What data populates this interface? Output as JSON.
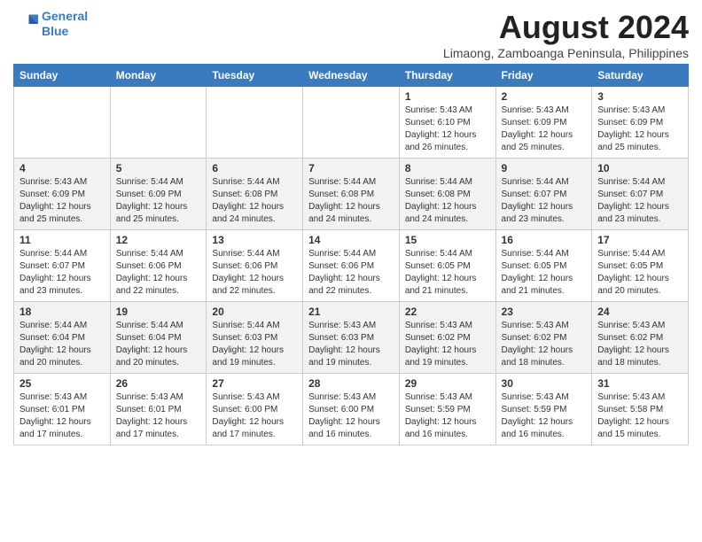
{
  "logo": {
    "line1": "General",
    "line2": "Blue"
  },
  "title": "August 2024",
  "subtitle": "Limaong, Zamboanga Peninsula, Philippines",
  "days_of_week": [
    "Sunday",
    "Monday",
    "Tuesday",
    "Wednesday",
    "Thursday",
    "Friday",
    "Saturday"
  ],
  "weeks": [
    [
      {
        "day": "",
        "info": ""
      },
      {
        "day": "",
        "info": ""
      },
      {
        "day": "",
        "info": ""
      },
      {
        "day": "",
        "info": ""
      },
      {
        "day": "1",
        "info": "Sunrise: 5:43 AM\nSunset: 6:10 PM\nDaylight: 12 hours\nand 26 minutes."
      },
      {
        "day": "2",
        "info": "Sunrise: 5:43 AM\nSunset: 6:09 PM\nDaylight: 12 hours\nand 25 minutes."
      },
      {
        "day": "3",
        "info": "Sunrise: 5:43 AM\nSunset: 6:09 PM\nDaylight: 12 hours\nand 25 minutes."
      }
    ],
    [
      {
        "day": "4",
        "info": "Sunrise: 5:43 AM\nSunset: 6:09 PM\nDaylight: 12 hours\nand 25 minutes."
      },
      {
        "day": "5",
        "info": "Sunrise: 5:44 AM\nSunset: 6:09 PM\nDaylight: 12 hours\nand 25 minutes."
      },
      {
        "day": "6",
        "info": "Sunrise: 5:44 AM\nSunset: 6:08 PM\nDaylight: 12 hours\nand 24 minutes."
      },
      {
        "day": "7",
        "info": "Sunrise: 5:44 AM\nSunset: 6:08 PM\nDaylight: 12 hours\nand 24 minutes."
      },
      {
        "day": "8",
        "info": "Sunrise: 5:44 AM\nSunset: 6:08 PM\nDaylight: 12 hours\nand 24 minutes."
      },
      {
        "day": "9",
        "info": "Sunrise: 5:44 AM\nSunset: 6:07 PM\nDaylight: 12 hours\nand 23 minutes."
      },
      {
        "day": "10",
        "info": "Sunrise: 5:44 AM\nSunset: 6:07 PM\nDaylight: 12 hours\nand 23 minutes."
      }
    ],
    [
      {
        "day": "11",
        "info": "Sunrise: 5:44 AM\nSunset: 6:07 PM\nDaylight: 12 hours\nand 23 minutes."
      },
      {
        "day": "12",
        "info": "Sunrise: 5:44 AM\nSunset: 6:06 PM\nDaylight: 12 hours\nand 22 minutes."
      },
      {
        "day": "13",
        "info": "Sunrise: 5:44 AM\nSunset: 6:06 PM\nDaylight: 12 hours\nand 22 minutes."
      },
      {
        "day": "14",
        "info": "Sunrise: 5:44 AM\nSunset: 6:06 PM\nDaylight: 12 hours\nand 22 minutes."
      },
      {
        "day": "15",
        "info": "Sunrise: 5:44 AM\nSunset: 6:05 PM\nDaylight: 12 hours\nand 21 minutes."
      },
      {
        "day": "16",
        "info": "Sunrise: 5:44 AM\nSunset: 6:05 PM\nDaylight: 12 hours\nand 21 minutes."
      },
      {
        "day": "17",
        "info": "Sunrise: 5:44 AM\nSunset: 6:05 PM\nDaylight: 12 hours\nand 20 minutes."
      }
    ],
    [
      {
        "day": "18",
        "info": "Sunrise: 5:44 AM\nSunset: 6:04 PM\nDaylight: 12 hours\nand 20 minutes."
      },
      {
        "day": "19",
        "info": "Sunrise: 5:44 AM\nSunset: 6:04 PM\nDaylight: 12 hours\nand 20 minutes."
      },
      {
        "day": "20",
        "info": "Sunrise: 5:44 AM\nSunset: 6:03 PM\nDaylight: 12 hours\nand 19 minutes."
      },
      {
        "day": "21",
        "info": "Sunrise: 5:43 AM\nSunset: 6:03 PM\nDaylight: 12 hours\nand 19 minutes."
      },
      {
        "day": "22",
        "info": "Sunrise: 5:43 AM\nSunset: 6:02 PM\nDaylight: 12 hours\nand 19 minutes."
      },
      {
        "day": "23",
        "info": "Sunrise: 5:43 AM\nSunset: 6:02 PM\nDaylight: 12 hours\nand 18 minutes."
      },
      {
        "day": "24",
        "info": "Sunrise: 5:43 AM\nSunset: 6:02 PM\nDaylight: 12 hours\nand 18 minutes."
      }
    ],
    [
      {
        "day": "25",
        "info": "Sunrise: 5:43 AM\nSunset: 6:01 PM\nDaylight: 12 hours\nand 17 minutes."
      },
      {
        "day": "26",
        "info": "Sunrise: 5:43 AM\nSunset: 6:01 PM\nDaylight: 12 hours\nand 17 minutes."
      },
      {
        "day": "27",
        "info": "Sunrise: 5:43 AM\nSunset: 6:00 PM\nDaylight: 12 hours\nand 17 minutes."
      },
      {
        "day": "28",
        "info": "Sunrise: 5:43 AM\nSunset: 6:00 PM\nDaylight: 12 hours\nand 16 minutes."
      },
      {
        "day": "29",
        "info": "Sunrise: 5:43 AM\nSunset: 5:59 PM\nDaylight: 12 hours\nand 16 minutes."
      },
      {
        "day": "30",
        "info": "Sunrise: 5:43 AM\nSunset: 5:59 PM\nDaylight: 12 hours\nand 16 minutes."
      },
      {
        "day": "31",
        "info": "Sunrise: 5:43 AM\nSunset: 5:58 PM\nDaylight: 12 hours\nand 15 minutes."
      }
    ]
  ]
}
